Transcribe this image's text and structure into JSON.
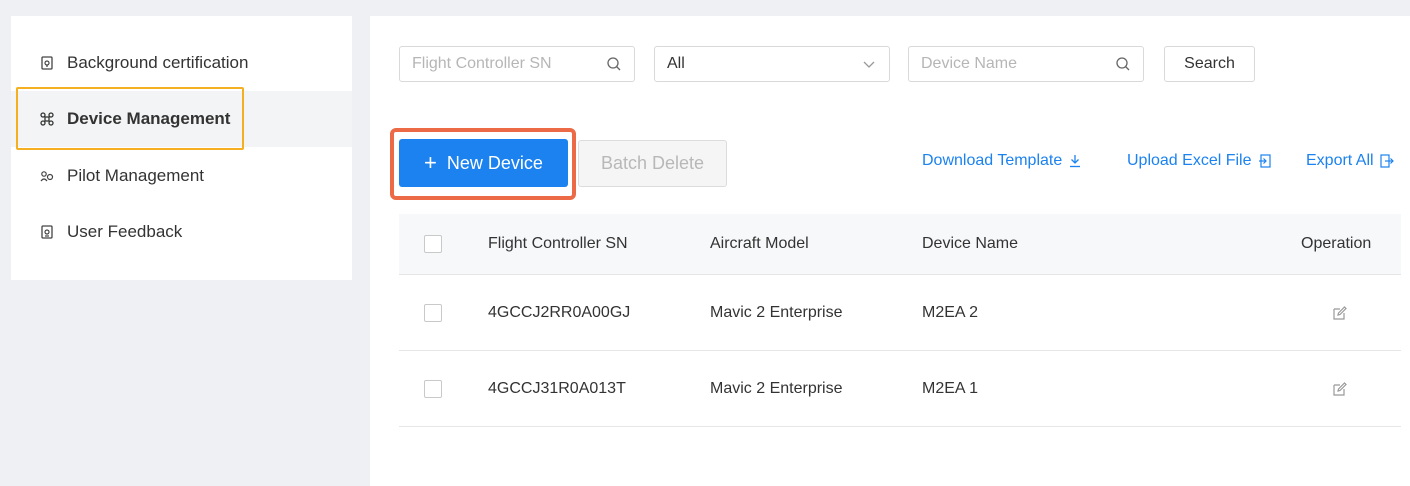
{
  "sidebar": {
    "items": [
      {
        "label": "Background certification",
        "icon": "certificate-icon"
      },
      {
        "label": "Device Management",
        "icon": "drone-icon",
        "active": true
      },
      {
        "label": "Pilot Management",
        "icon": "pilot-icon"
      },
      {
        "label": "User Feedback",
        "icon": "feedback-icon"
      }
    ]
  },
  "filters": {
    "sn_placeholder": "Flight Controller SN",
    "model_select_value": "All",
    "name_placeholder": "Device Name",
    "search_label": "Search"
  },
  "actions": {
    "new_device_label": "New Device",
    "batch_delete_label": "Batch Delete",
    "download_template_label": "Download Template",
    "upload_excel_label": "Upload Excel File",
    "export_all_label": "Export All"
  },
  "table": {
    "columns": [
      "Flight Controller SN",
      "Aircraft Model",
      "Device Name",
      "Operation"
    ],
    "rows": [
      {
        "sn": "4GCCJ2RR0A00GJ",
        "model": "Mavic 2 Enterprise",
        "name": "M2EA 2"
      },
      {
        "sn": "4GCCJ31R0A013T",
        "model": "Mavic 2 Enterprise",
        "name": "M2EA 1"
      }
    ]
  },
  "colors": {
    "accent": "#1b82f0",
    "highlight_outline": "#ec6a45",
    "active_outline": "#f5b021"
  }
}
